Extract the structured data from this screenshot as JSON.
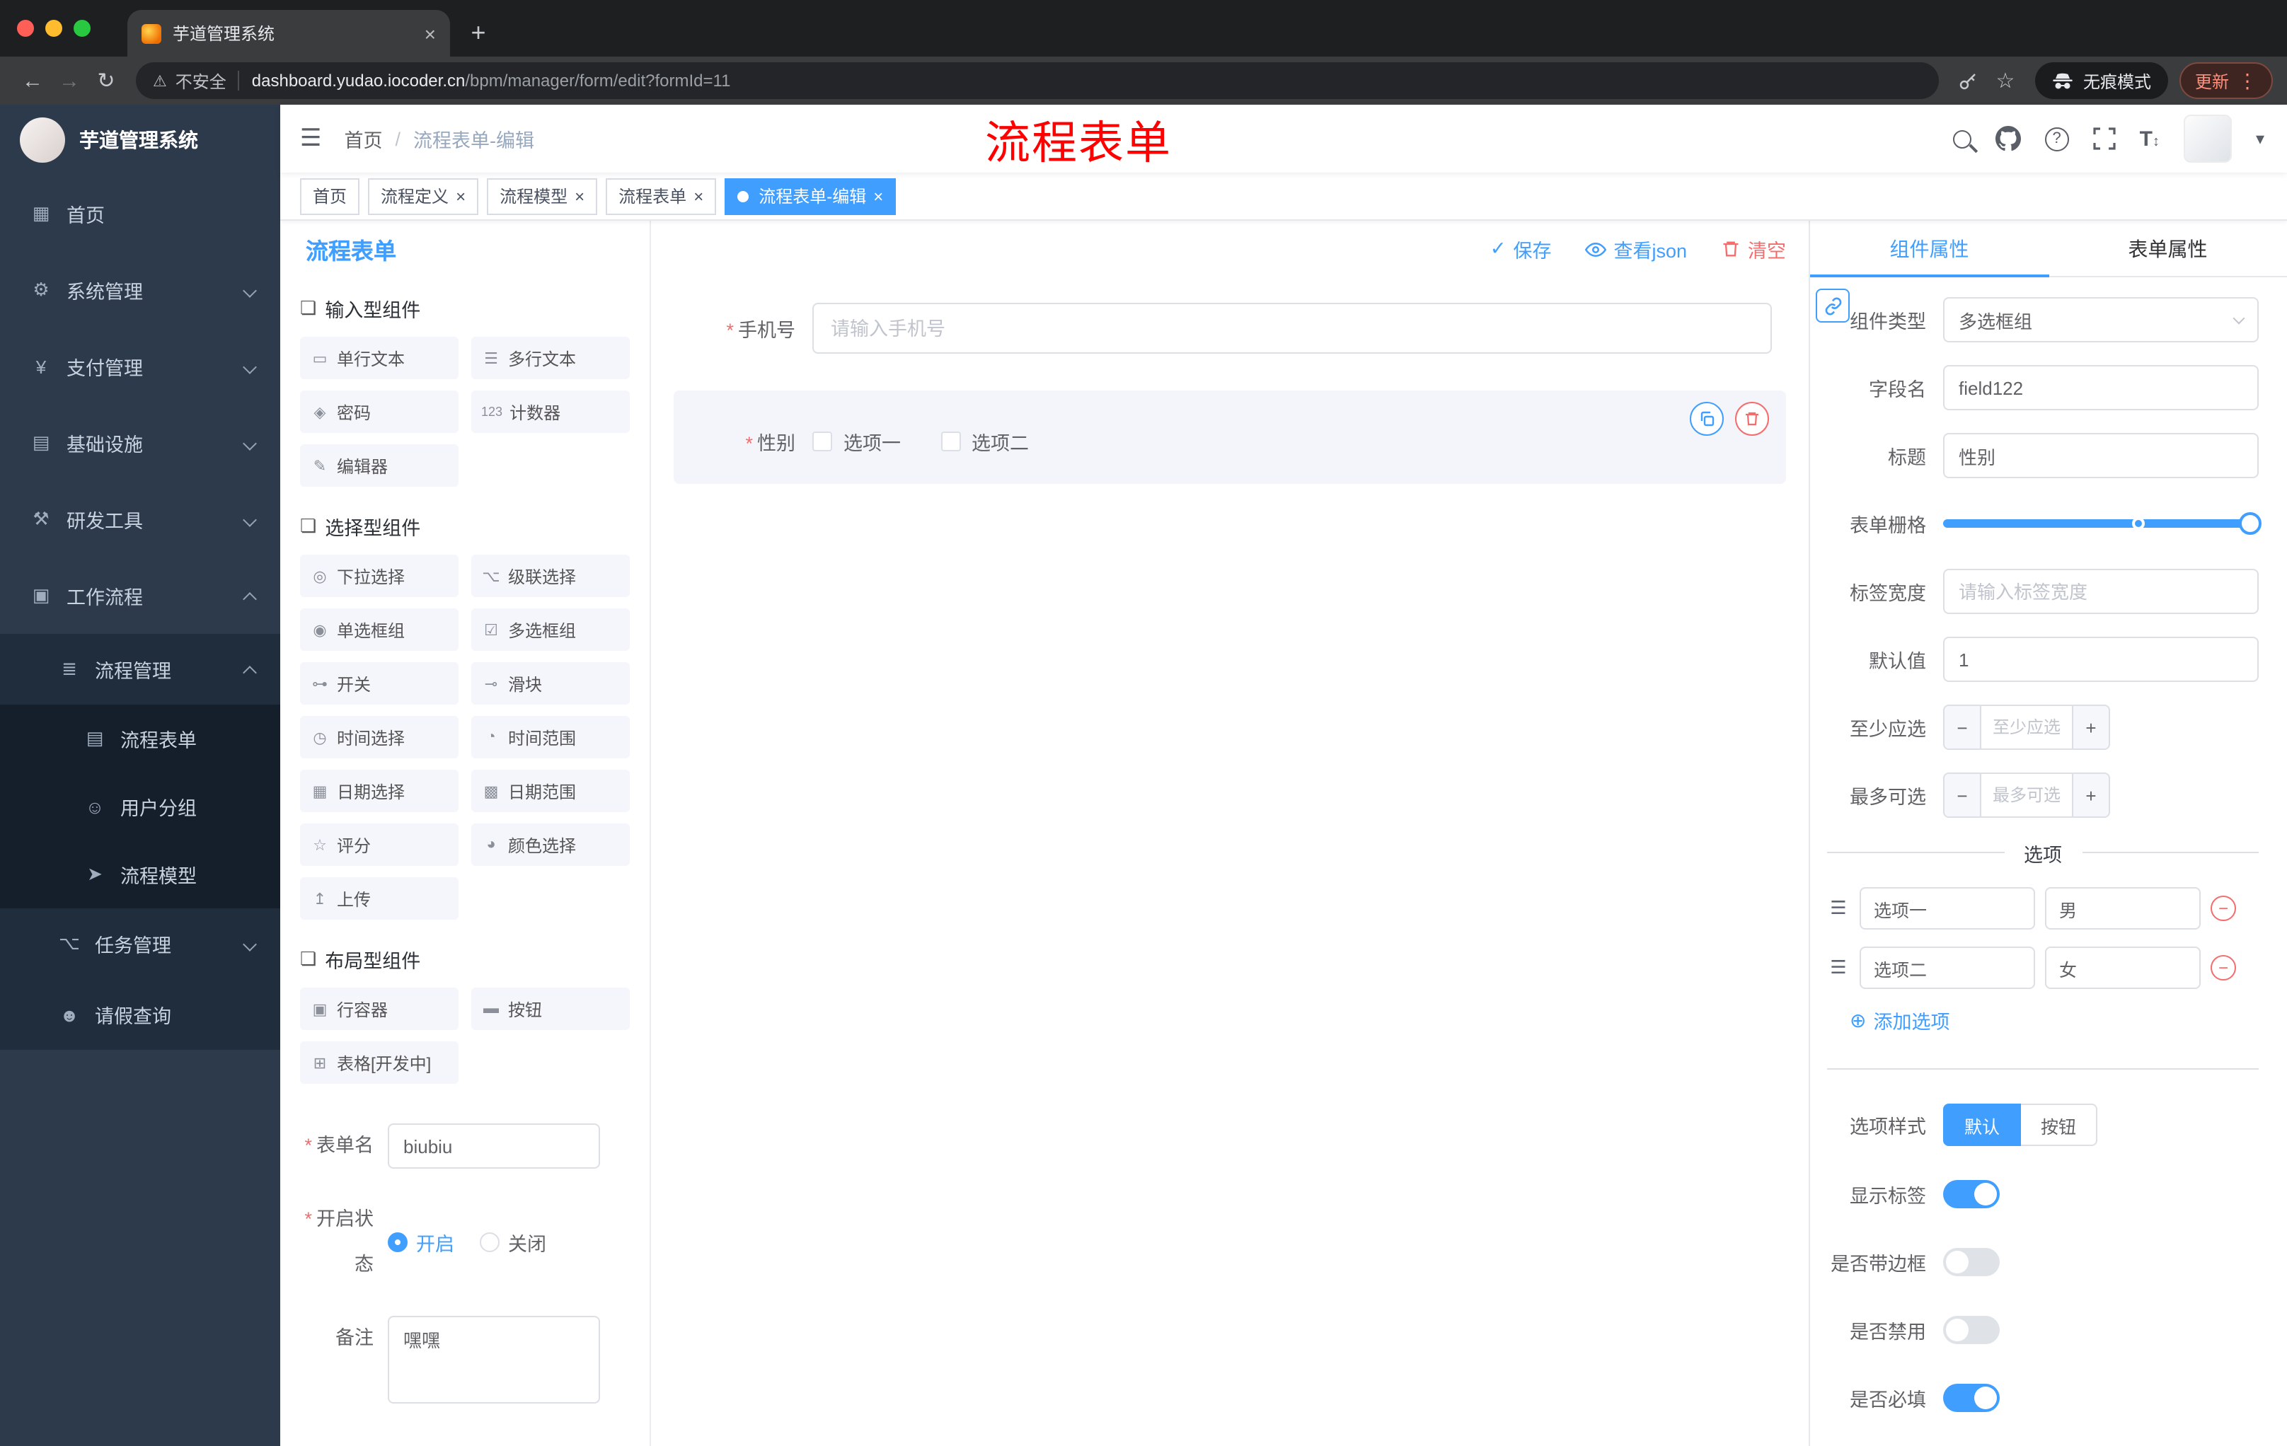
{
  "colors": {
    "accent": "#409eff",
    "danger": "#f56c6c",
    "annotation_red": "#ff0000",
    "sidebar_bg": "#2d3a4b",
    "tag_active_bg": "#409eff"
  },
  "browser": {
    "tab_title": "芋道管理系统",
    "security_label": "不安全",
    "url_host": "dashboard.yudao.iocoder.cn",
    "url_path": "/bpm/manager/form/edit?formId=11",
    "incognito_label": "无痕模式",
    "update_label": "更新"
  },
  "sidebar": {
    "app_title": "芋道管理系统",
    "items": [
      {
        "label": "首页",
        "icon": "▦"
      },
      {
        "label": "系统管理",
        "icon": "⚙"
      },
      {
        "label": "支付管理",
        "icon": "¥"
      },
      {
        "label": "基础设施",
        "icon": "▤"
      },
      {
        "label": "研发工具",
        "icon": "⚒"
      },
      {
        "label": "工作流程",
        "icon": "▣"
      },
      {
        "label": "流程管理",
        "icon": "≣"
      },
      {
        "label": "流程表单",
        "icon": "▤"
      },
      {
        "label": "用户分组",
        "icon": "☺"
      },
      {
        "label": "流程模型",
        "icon": "➤"
      },
      {
        "label": "任务管理",
        "icon": "⌥"
      },
      {
        "label": "请假查询",
        "icon": "☻"
      }
    ]
  },
  "header": {
    "breadcrumb_home": "首页",
    "breadcrumb_sep": "/",
    "breadcrumb_current": "流程表单-编辑",
    "annotation": "流程表单"
  },
  "tags": [
    {
      "label": "首页",
      "closable": false,
      "active": false
    },
    {
      "label": "流程定义",
      "closable": true,
      "active": false
    },
    {
      "label": "流程模型",
      "closable": true,
      "active": false
    },
    {
      "label": "流程表单",
      "closable": true,
      "active": false
    },
    {
      "label": "流程表单-编辑",
      "closable": true,
      "active": true
    }
  ],
  "builder": {
    "panel_title": "流程表单",
    "save_label": "保存",
    "view_json_label": "查看json",
    "clear_label": "清空",
    "groups": [
      {
        "title": "输入型组件",
        "items": [
          {
            "label": "单行文本",
            "icon": "▭"
          },
          {
            "label": "多行文本",
            "icon": "☰"
          },
          {
            "label": "密码",
            "icon": "◈"
          },
          {
            "label": "计数器",
            "icon": "123"
          },
          {
            "label": "编辑器",
            "icon": "✎"
          }
        ]
      },
      {
        "title": "选择型组件",
        "items": [
          {
            "label": "下拉选择",
            "icon": "◎"
          },
          {
            "label": "级联选择",
            "icon": "⌥"
          },
          {
            "label": "单选框组",
            "icon": "◉"
          },
          {
            "label": "多选框组",
            "icon": "☑"
          },
          {
            "label": "开关",
            "icon": "⊶"
          },
          {
            "label": "滑块",
            "icon": "⊸"
          },
          {
            "label": "时间选择",
            "icon": "◷"
          },
          {
            "label": "时间范围",
            "icon": "◔"
          },
          {
            "label": "日期选择",
            "icon": "▦"
          },
          {
            "label": "日期范围",
            "icon": "▩"
          },
          {
            "label": "评分",
            "icon": "☆"
          },
          {
            "label": "颜色选择",
            "icon": "◕"
          },
          {
            "label": "上传",
            "icon": "↥"
          }
        ]
      },
      {
        "title": "布局型组件",
        "items": [
          {
            "label": "行容器",
            "icon": "▣"
          },
          {
            "label": "按钮",
            "icon": "▬"
          },
          {
            "label": "表格[开发中]",
            "icon": "⊞"
          }
        ]
      }
    ],
    "form_name_label": "表单名",
    "form_name_value": "biubiu",
    "status_label": "开启状态",
    "status_on": "开启",
    "status_off": "关闭",
    "remark_label": "备注",
    "remark_value": "嘿嘿",
    "canvas": {
      "phone_label": "手机号",
      "phone_placeholder": "请输入手机号",
      "gender_label": "性别",
      "gender_options": [
        "选项一",
        "选项二"
      ]
    }
  },
  "props": {
    "tab_component": "组件属性",
    "tab_form": "表单属性",
    "type_label": "组件类型",
    "type_value": "多选框组",
    "field_label": "字段名",
    "field_value": "field122",
    "title_label": "标题",
    "title_value": "性别",
    "grid_label": "表单栅格",
    "label_width_label": "标签宽度",
    "label_width_placeholder": "请输入标签宽度",
    "default_label": "默认值",
    "default_value": "1",
    "min_label": "至少应选",
    "min_placeholder": "至少应选",
    "max_label": "最多可选",
    "max_placeholder": "最多可选",
    "options_title": "选项",
    "options": [
      {
        "name": "选项一",
        "value": "男"
      },
      {
        "name": "选项二",
        "value": "女"
      }
    ],
    "add_option_label": "添加选项",
    "style_label": "选项样式",
    "style_default": "默认",
    "style_button": "按钮",
    "switch_show_label": "显示标签",
    "switch_border": "是否带边框",
    "switch_disabled": "是否禁用",
    "switch_required": "是否必填"
  }
}
